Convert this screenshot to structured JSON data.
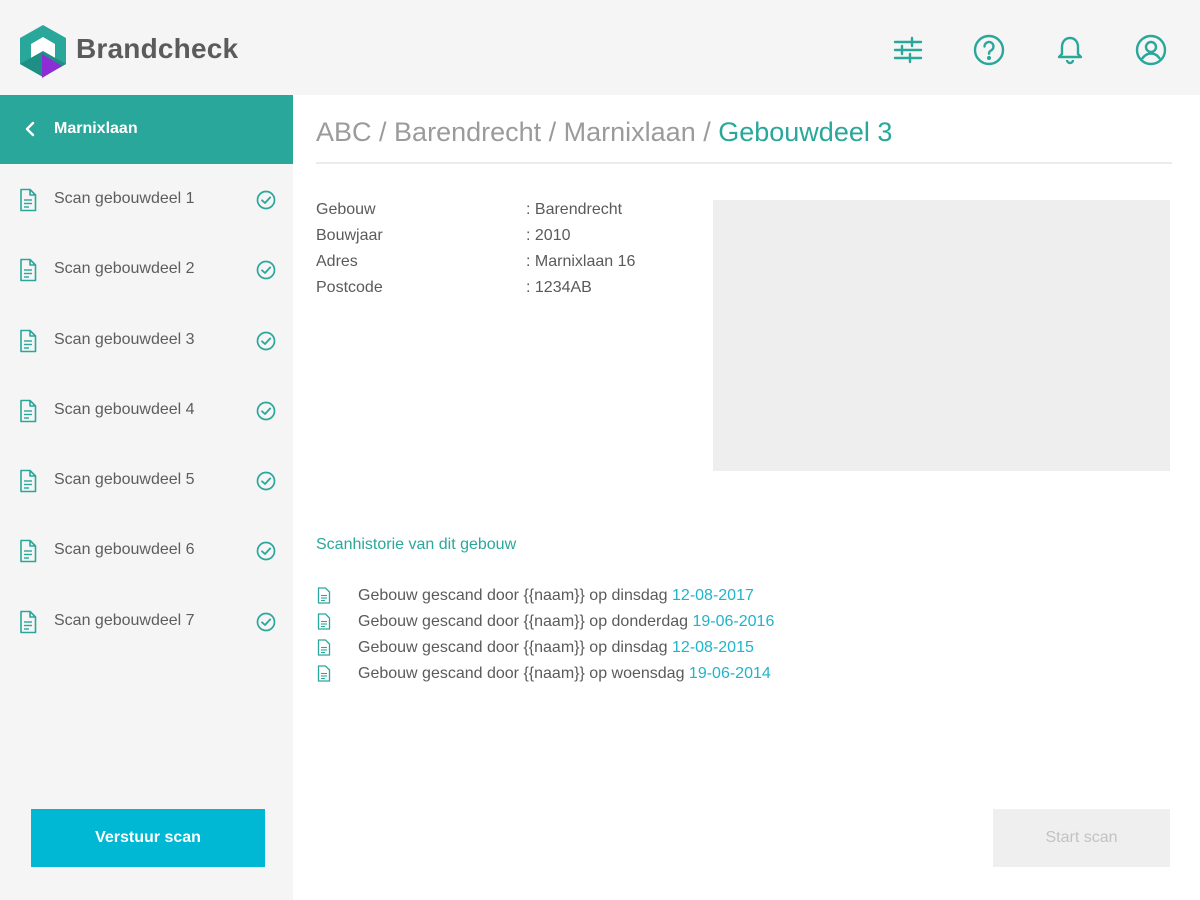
{
  "header": {
    "brand": "Brandcheck",
    "icons": [
      "filter-icon",
      "help-icon",
      "bell-icon",
      "account-icon"
    ]
  },
  "colors": {
    "accent": "#2aa79b",
    "action": "#00b8d4",
    "link": "#1fb4c9"
  },
  "sidebar": {
    "back_label": "Marnixlaan",
    "items": [
      {
        "label": "Scan gebouwdeel 1",
        "done": true
      },
      {
        "label": "Scan gebouwdeel 2",
        "done": true
      },
      {
        "label": "Scan gebouwdeel 3",
        "done": true
      },
      {
        "label": "Scan gebouwdeel 4",
        "done": true
      },
      {
        "label": "Scan gebouwdeel 5",
        "done": true
      },
      {
        "label": "Scan gebouwdeel 6",
        "done": true
      },
      {
        "label": "Scan gebouwdeel 7",
        "done": true
      }
    ],
    "send_label": "Verstuur scan"
  },
  "breadcrumb": {
    "parts": [
      "ABC",
      "Barendrecht",
      "Marnixlaan"
    ],
    "separator": " / ",
    "current": "Gebouwdeel 3"
  },
  "details": [
    {
      "key": "Gebouw",
      "value": ": Barendrecht"
    },
    {
      "key": "Bouwjaar",
      "value": ": 2010"
    },
    {
      "key": "Adres",
      "value": ": Marnixlaan 16"
    },
    {
      "key": "Postcode",
      "value": ": 1234AB"
    }
  ],
  "history": {
    "title": "Scanhistorie van dit gebouw",
    "entries": [
      {
        "text": "Gebouw gescand door {{naam}} op dinsdag ",
        "date": "12-08-2017"
      },
      {
        "text": "Gebouw gescand door {{naam}} op donderdag ",
        "date": "19-06-2016"
      },
      {
        "text": "Gebouw gescand door {{naam}} op dinsdag ",
        "date": "12-08-2015"
      },
      {
        "text": "Gebouw gescand door {{naam}} op woensdag ",
        "date": "19-06-2014"
      }
    ]
  },
  "start_label": "Start scan"
}
